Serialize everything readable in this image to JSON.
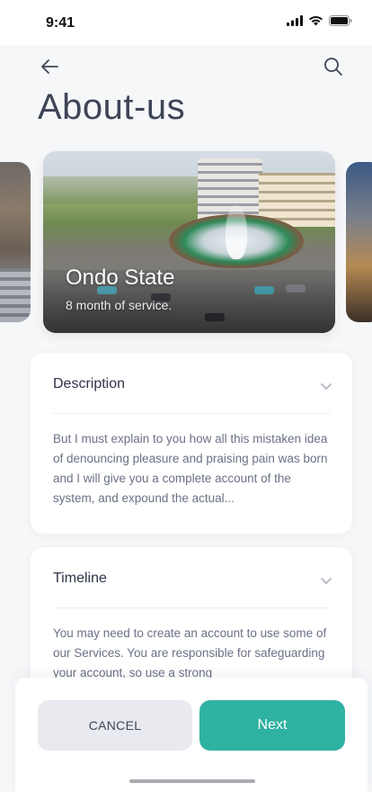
{
  "status_bar": {
    "time": "9:41"
  },
  "header": {
    "title": "About-us"
  },
  "carousel": {
    "active": {
      "title": "Ondo State",
      "subtitle": "8 month of service."
    }
  },
  "sections": {
    "description": {
      "title": "Description",
      "body": "But I must explain to you how all this mistaken idea of denouncing pleasure and praising pain was born and I will give you a complete account of the system, and expound the actual..."
    },
    "timeline": {
      "title": "Timeline",
      "body": "You may need to create an account to use some of our Services. You are responsible for safeguarding your account, so use a strong"
    }
  },
  "footer": {
    "cancel_label": "CANCEL",
    "next_label": "Next"
  },
  "colors": {
    "accent": "#2eb2a2",
    "title": "#3e4557",
    "body_text": "#6b7186",
    "cancel_bg": "#e9eaef"
  },
  "icons": [
    "back-arrow-icon",
    "search-icon",
    "chevron-down-icon",
    "signal-icon",
    "wifi-icon",
    "battery-icon"
  ]
}
